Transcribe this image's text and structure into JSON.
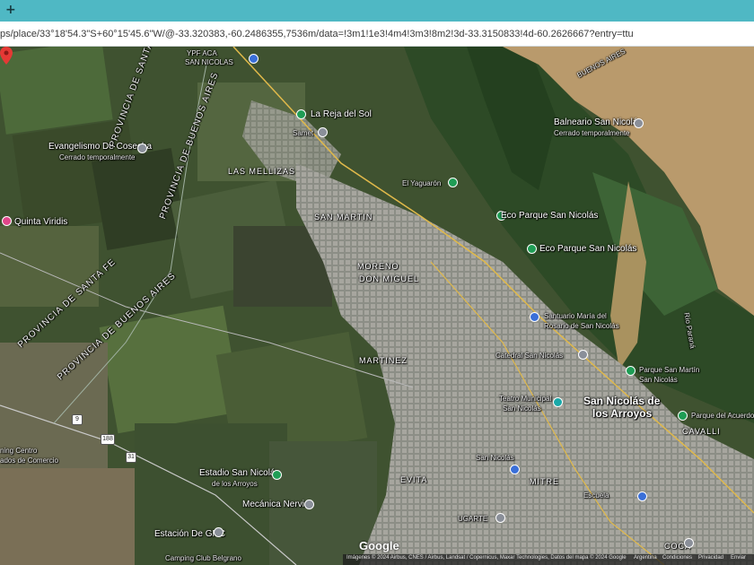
{
  "browser": {
    "newtab_label": "+",
    "url": "ps/place/33°18'54.3\"S+60°15'45.6\"W/@-33.320383,-60.2486355,7536m/data=!3m1!1e3!4m4!3m3!8m2!3d-33.3150833!4d-60.2626667?entry=ttu"
  },
  "map": {
    "labels": {
      "ypf": "YPF ACA",
      "ypf2": "SAN NICOLAS",
      "la_reja": "La Reja del Sol",
      "samet": "Samet",
      "evangelismo": "Evangelismo De Cosecha",
      "evangelismo_status": "Cerrado temporalmente",
      "las_mellizas": "LAS MELLIZAS",
      "el_yaguaron": "El Yaguarón",
      "san_martin": "SAN MARTIN",
      "quinta_viridis": "Quinta Viridis",
      "moreno": "MORENO",
      "don_miguel": "DON MIGUEL",
      "balneario": "Balneario San Nicolás",
      "balneario_status": "Cerrado temporalmente",
      "eco_parque_1": "Eco Parque San Nicolás",
      "eco_parque_2": "Eco Parque San Nicolás",
      "santuario": "Santuario María del",
      "santuario2": "Rosario de San Nicolás",
      "martinez": "MARTINEZ",
      "catedral": "Catedral San Nicolás",
      "teatro": "Teatro Municipal",
      "teatro2": "San Nicolás",
      "san_nicolas_city": "San Nicolás de",
      "san_nicolas_city2": "los Arroyos",
      "parque_san_martin": "Parque San Martín",
      "parque_san_martin2": "San Nicolás",
      "parque_acuerdo": "Parque del Acuerdo",
      "cavalli": "CAVALLI",
      "rio_parana": "Río Paraná",
      "buenos_aires_river": "BUENOS AIRES",
      "prov_santa_fe_1": "PROVINCIA DE SANTA FE",
      "prov_buenos_aires_1": "PROVINCIA DE BUENOS AIRES",
      "prov_santa_fe_2": "PROVINCIA DE SANTA FE",
      "prov_buenos_aires_2": "PROVINCIA DE BUENOS AIRES",
      "centro_comercio": "ning Centro",
      "centro_comercio2": "ados de Comercio",
      "estadio": "Estadio San Nicolás",
      "estadio2": "de los Arroyos",
      "mecanica": "Mecánica Nervis",
      "estacion": "Estación De GNC",
      "camping": "Camping Club Belgrano",
      "evita": "EVITA",
      "mitre": "MITRE",
      "ugarte": "UGARTE",
      "san_nicolas_coll": "San Nicolás",
      "escuela": "Escuela",
      "coca": "COCA",
      "route_9": "9",
      "route_188": "188",
      "prov_31": "31"
    },
    "google_logo": "Google",
    "attribution": "Imágenes © 2024 Airbus, CNES / Airbus, Landsat / Copernicus, Maxar Technologies, Datos del mapa © 2024 Google",
    "footer_links": [
      "Argentina",
      "Condiciones",
      "Privacidad",
      "Enviar"
    ],
    "colors": {
      "tab": "#4fb8c4",
      "river": "#b99a6c",
      "pin_red": "#e53935"
    }
  }
}
